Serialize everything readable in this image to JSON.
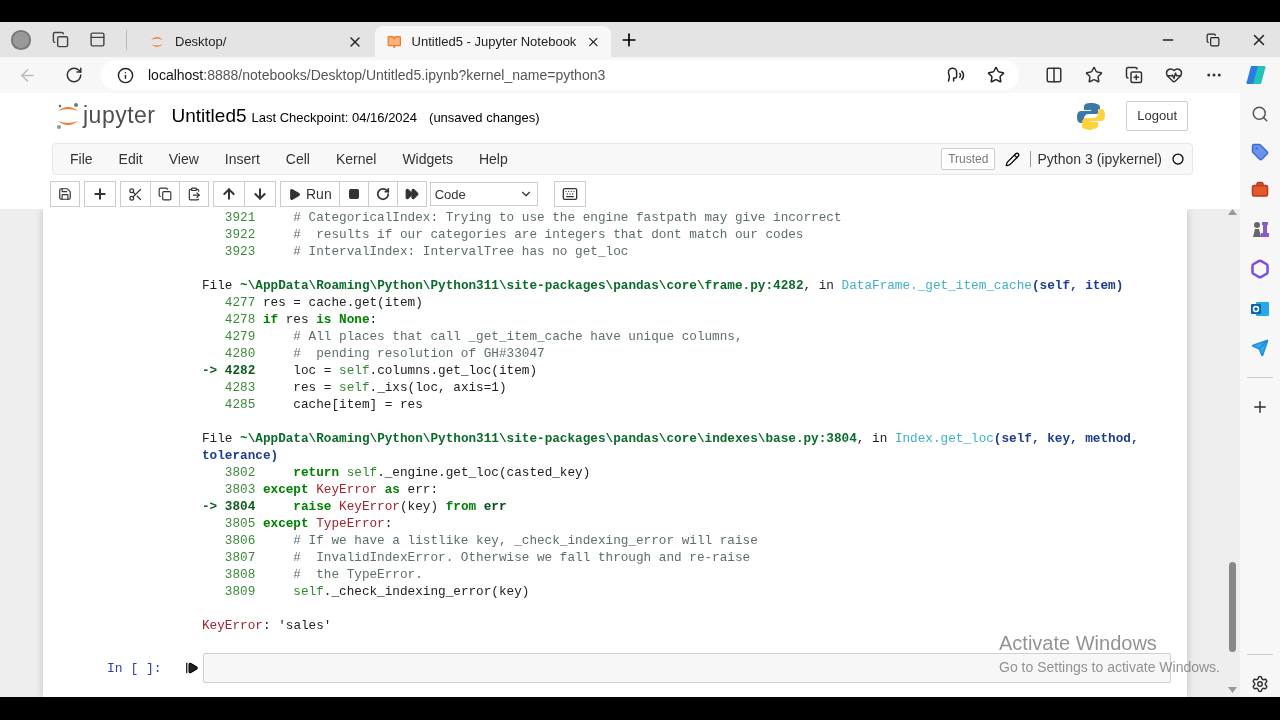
{
  "browser": {
    "tabs": [
      {
        "kind": "jupyter",
        "title": "Desktop/",
        "selected": false
      },
      {
        "kind": "notebook",
        "title": "Untitled5 - Jupyter Notebook",
        "selected": true
      }
    ],
    "url_host": "localhost",
    "url_rest": ":8888/notebooks/Desktop/Untitled5.ipynb?kernel_name=python3"
  },
  "header": {
    "brand": "jupyter",
    "name": "Untitled5",
    "checkpoint": "Last Checkpoint: 04/16/2024",
    "status": "(unsaved changes)",
    "logout": "Logout"
  },
  "menu": [
    "File",
    "Edit",
    "View",
    "Insert",
    "Cell",
    "Kernel",
    "Widgets",
    "Help"
  ],
  "trusted": "Trusted",
  "kernel": "Python 3 (ipykernel)",
  "toolbar": {
    "run": "Run",
    "cell_type": "Code"
  },
  "traceback": [
    {
      "lines": [
        {
          "number": "3921",
          "code": [
            {
              "kind": "comment",
              "text": "    # CategoricalIndex: Trying to use the engine fastpath may give incorrect"
            }
          ]
        },
        {
          "number": "3922",
          "code": [
            {
              "kind": "comment",
              "text": "    #  results if our categories are integers that dont match our codes"
            }
          ]
        },
        {
          "number": "3923",
          "code": [
            {
              "kind": "comment",
              "text": "    # IntervalIndex: IntervalTree has no get_loc"
            }
          ]
        }
      ]
    },
    {
      "file": [
        {
          "kind": "plain",
          "text": "File "
        },
        {
          "kind": "path",
          "text": "~\\AppData\\Roaming\\Python\\Python311\\site-packages\\pandas\\core\\frame.py:4282"
        },
        {
          "kind": "plain",
          "text": ", in "
        },
        {
          "kind": "func",
          "text": "DataFrame._get_item_cache"
        },
        {
          "kind": "args",
          "text": "(self, item)"
        }
      ],
      "lines": [
        {
          "number": "4277",
          "code": [
            {
              "kind": "plain",
              "text": "res = cache.get(item)"
            }
          ]
        },
        {
          "number": "4278",
          "code": [
            {
              "kind": "kw",
              "text": "if"
            },
            {
              "kind": "plain",
              "text": " res "
            },
            {
              "kind": "kw",
              "text": "is None"
            },
            {
              "kind": "plain",
              "text": ":"
            }
          ]
        },
        {
          "number": "4279",
          "code": [
            {
              "kind": "comment",
              "text": "    # All places that call _get_item_cache have unique columns,"
            }
          ]
        },
        {
          "number": "4280",
          "code": [
            {
              "kind": "comment",
              "text": "    #  pending resolution of GH#33047"
            }
          ]
        },
        {
          "number": "4282",
          "marker": "->",
          "code": [
            {
              "kind": "plain",
              "text": "    loc = "
            },
            {
              "kind": "self",
              "text": "self"
            },
            {
              "kind": "plain",
              "text": ".columns.get_loc(item)"
            }
          ]
        },
        {
          "number": "4283",
          "code": [
            {
              "kind": "plain",
              "text": "    res = "
            },
            {
              "kind": "self",
              "text": "self"
            },
            {
              "kind": "plain",
              "text": "._ixs(loc, axis=1)"
            }
          ]
        },
        {
          "number": "4285",
          "code": [
            {
              "kind": "plain",
              "text": "    cache[item] = res"
            }
          ]
        }
      ]
    },
    {
      "file": [
        {
          "kind": "plain",
          "text": "File "
        },
        {
          "kind": "path",
          "text": "~\\AppData\\Roaming\\Python\\Python311\\site-packages\\pandas\\core\\indexes\\base.py:3804"
        },
        {
          "kind": "plain",
          "text": ", in "
        },
        {
          "kind": "func",
          "text": "Index.get_loc"
        },
        {
          "kind": "args",
          "text": "(self, key, method, tolerance)"
        }
      ],
      "lines": [
        {
          "number": "3802",
          "code": [
            {
              "kind": "kw",
              "text": "    return"
            },
            {
              "kind": "self",
              "text": " self"
            },
            {
              "kind": "plain",
              "text": "._engine.get_loc(casted_key)"
            }
          ]
        },
        {
          "number": "3803",
          "code": [
            {
              "kind": "kw",
              "text": "except"
            },
            {
              "kind": "exc",
              "text": " KeyError"
            },
            {
              "kind": "kw",
              "text": " as"
            },
            {
              "kind": "plain",
              "text": " err:"
            }
          ]
        },
        {
          "number": "3804",
          "marker": "->",
          "code": [
            {
              "kind": "kw",
              "text": "    raise"
            },
            {
              "kind": "exc",
              "text": " KeyError"
            },
            {
              "kind": "plain",
              "text": "(key) "
            },
            {
              "kind": "kw",
              "text": "from"
            },
            {
              "kind": "bold",
              "text": " err"
            }
          ]
        },
        {
          "number": "3805",
          "code": [
            {
              "kind": "kw",
              "text": "except"
            },
            {
              "kind": "exc",
              "text": " TypeError"
            },
            {
              "kind": "plain",
              "text": ":"
            }
          ]
        },
        {
          "number": "3806",
          "code": [
            {
              "kind": "comment",
              "text": "    # If we have a listlike key, _check_indexing_error will raise"
            }
          ]
        },
        {
          "number": "3807",
          "code": [
            {
              "kind": "comment",
              "text": "    #  InvalidIndexError. Otherwise we fall through and re-raise"
            }
          ]
        },
        {
          "number": "3808",
          "code": [
            {
              "kind": "comment",
              "text": "    #  the TypeError."
            }
          ]
        },
        {
          "number": "3809",
          "code": [
            {
              "kind": "self",
              "text": "    self"
            },
            {
              "kind": "plain",
              "text": "._check_indexing_error(key)"
            }
          ]
        }
      ]
    }
  ],
  "error": [
    {
      "kind": "exc",
      "text": "KeyError"
    },
    {
      "kind": "plain",
      "text": ": 'sales'"
    }
  ],
  "input_cell": {
    "prompt": "In [ ]:"
  },
  "os_notice": {
    "title": "Activate Windows",
    "text": "Go to Settings to activate Windows."
  }
}
